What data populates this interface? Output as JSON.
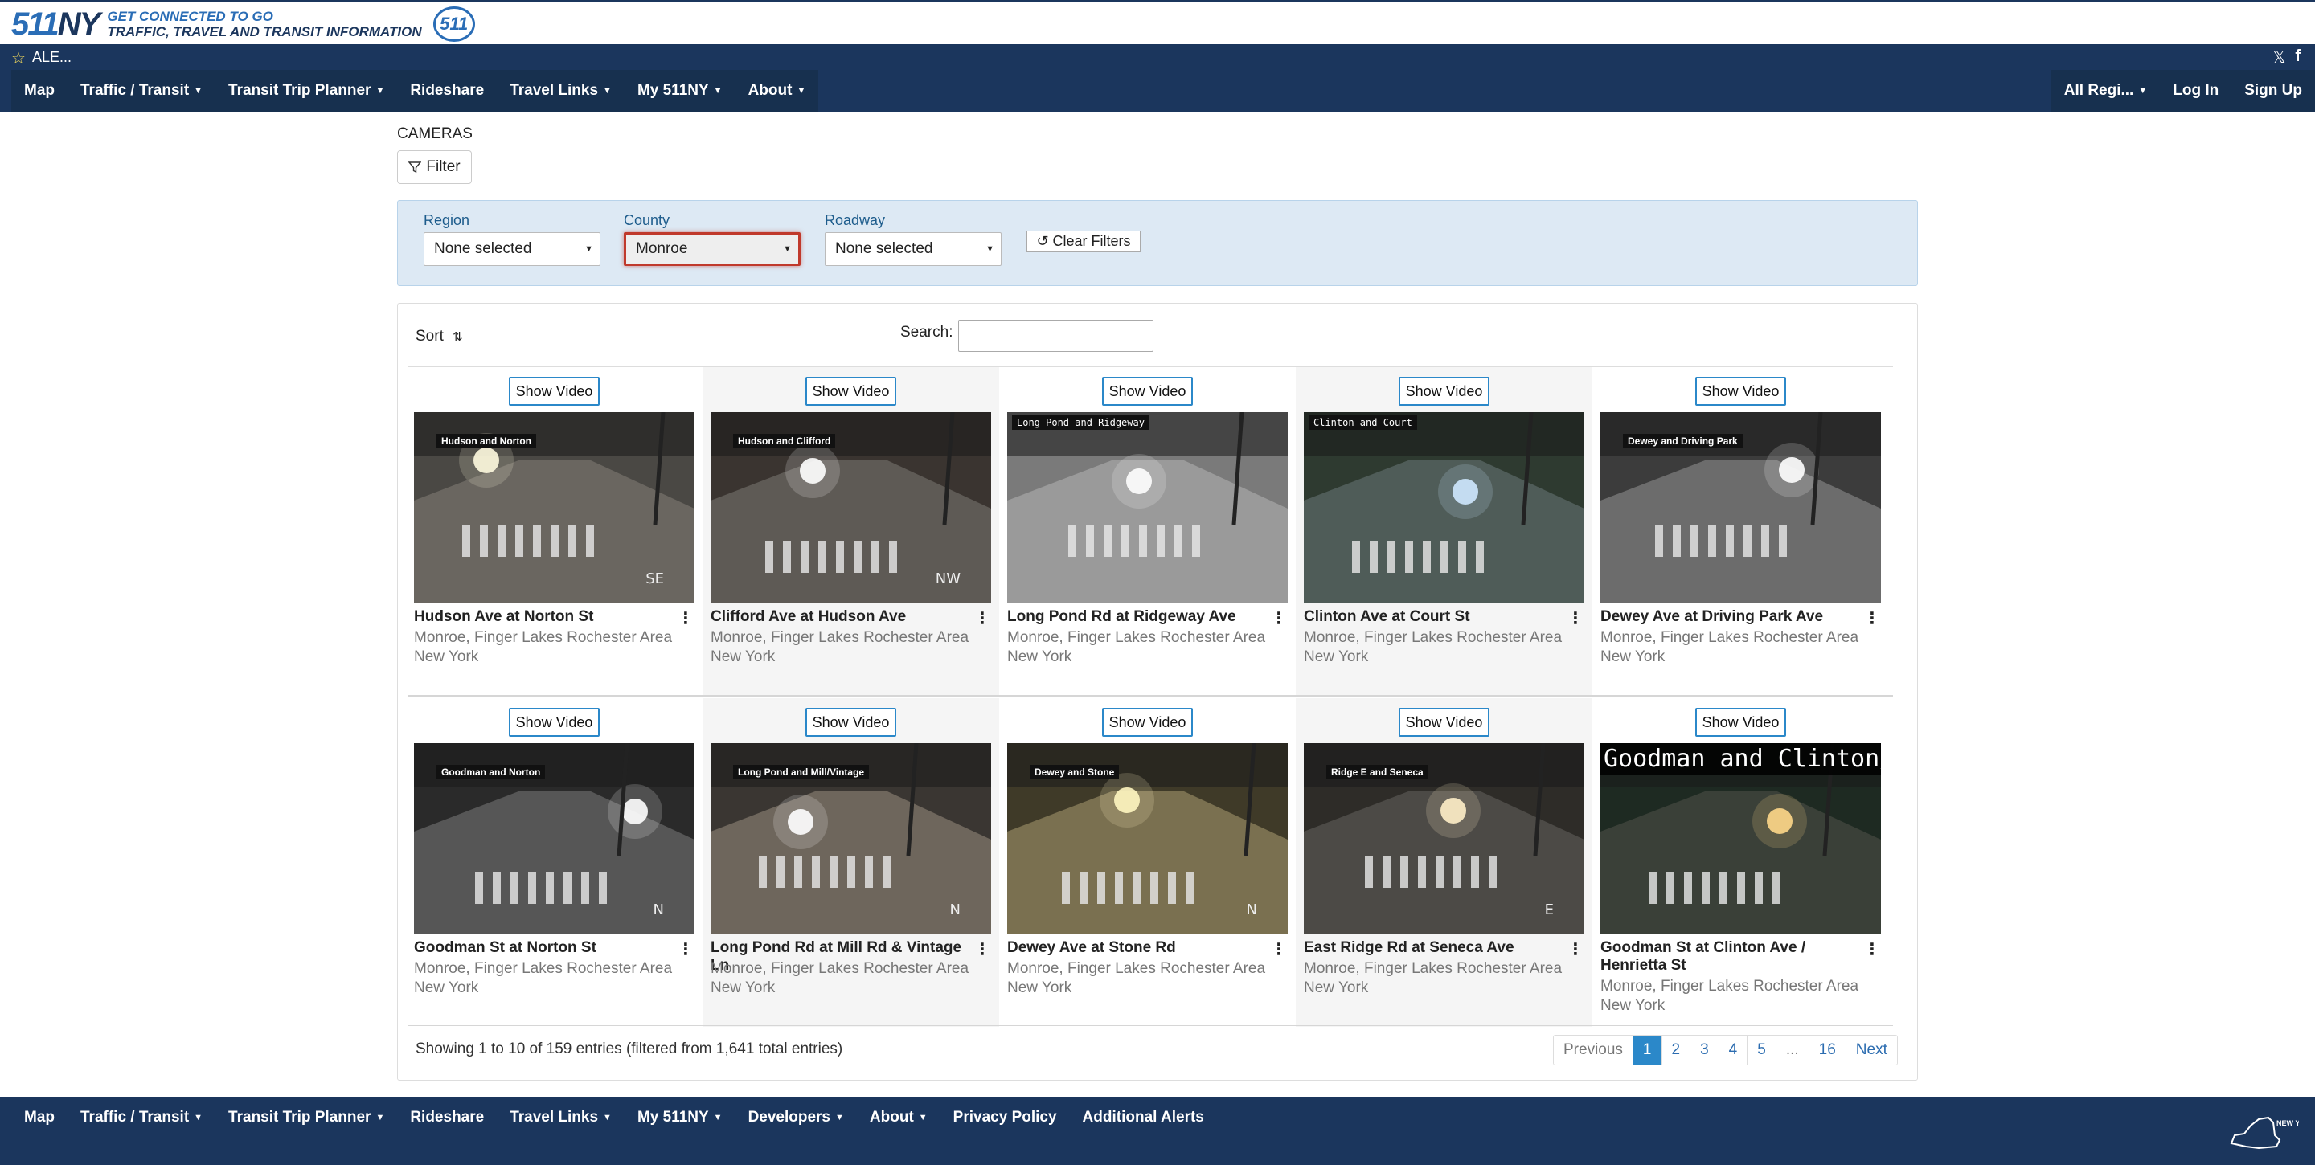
{
  "header": {
    "logo_511": "511",
    "logo_ny": "NY",
    "tagline_1": "GET CONNECTED TO GO",
    "tagline_2": "TRAFFIC, TRAVEL AND TRANSIT INFORMATION",
    "badge": "511"
  },
  "alert": {
    "text": "ALE..."
  },
  "nav": {
    "left": [
      {
        "label": "Map",
        "caret": false
      },
      {
        "label": "Traffic / Transit",
        "caret": true
      },
      {
        "label": "Transit Trip Planner",
        "caret": true
      },
      {
        "label": "Rideshare",
        "caret": false
      },
      {
        "label": "Travel Links",
        "caret": true
      },
      {
        "label": "My 511NY",
        "caret": true
      },
      {
        "label": "About",
        "caret": true
      }
    ],
    "right": [
      {
        "label": "All Regi...",
        "caret": true
      },
      {
        "label": "Log In",
        "caret": false
      },
      {
        "label": "Sign Up",
        "caret": false
      }
    ]
  },
  "page": {
    "heading": "CAMERAS",
    "filter_button": "Filter"
  },
  "filters": {
    "region": {
      "label": "Region",
      "value": "None selected"
    },
    "county": {
      "label": "County",
      "value": "Monroe"
    },
    "roadway": {
      "label": "Roadway",
      "value": "None selected"
    },
    "clear_label": "Clear Filters"
  },
  "table": {
    "sort_label": "Sort",
    "search_label": "Search:",
    "search_value": "",
    "show_video_label": "Show Video",
    "cameras": [
      {
        "title": "Hudson Ave at Norton St",
        "loc1": "Monroe, Finger Lakes Rochester Area",
        "loc2": "New York",
        "tag": "Hudson and Norton",
        "dir": "SE"
      },
      {
        "title": "Clifford Ave at Hudson Ave",
        "loc1": "Monroe, Finger Lakes Rochester Area",
        "loc2": "New York",
        "tag": "Hudson and Clifford",
        "dir": "NW"
      },
      {
        "title": "Long Pond Rd at Ridgeway Ave",
        "loc1": "Monroe, Finger Lakes Rochester Area",
        "loc2": "New York",
        "tag": "Long Pond and Ridgeway",
        "dir": ""
      },
      {
        "title": "Clinton Ave at Court St",
        "loc1": "Monroe, Finger Lakes Rochester Area",
        "loc2": "New York",
        "tag": "Clinton and Court",
        "dir": ""
      },
      {
        "title": "Dewey Ave at Driving Park Ave",
        "loc1": "Monroe, Finger Lakes Rochester Area",
        "loc2": "New York",
        "tag": "Dewey and Driving Park",
        "dir": ""
      },
      {
        "title": "Goodman St at Norton St",
        "loc1": "Monroe, Finger Lakes Rochester Area",
        "loc2": "New York",
        "tag": "Goodman and Norton",
        "dir": "N"
      },
      {
        "title": "Long Pond Rd at Mill Rd & Vintage Ln",
        "loc1": "Monroe, Finger Lakes Rochester Area",
        "loc2": "New York",
        "tag": "Long Pond and Mill/Vintage",
        "dir": "N"
      },
      {
        "title": "Dewey Ave at Stone Rd",
        "loc1": "Monroe, Finger Lakes Rochester Area",
        "loc2": "New York",
        "tag": "Dewey and Stone",
        "dir": "N"
      },
      {
        "title": "East Ridge Rd at Seneca Ave",
        "loc1": "Monroe, Finger Lakes Rochester Area",
        "loc2": "New York",
        "tag": "Ridge E and Seneca",
        "dir": "E"
      },
      {
        "title": "Goodman St at Clinton Ave / Henrietta St",
        "loc1": "Monroe, Finger Lakes Rochester Area",
        "loc2": "New York",
        "tag": "Goodman and Clinton/",
        "dir": ""
      }
    ],
    "entries_info": "Showing 1 to 10 of 159 entries (filtered from 1,641 total entries)",
    "pagination": [
      "Previous",
      "1",
      "2",
      "3",
      "4",
      "5",
      "...",
      "16",
      "Next"
    ],
    "current_page": "1"
  },
  "footer": {
    "nav": [
      {
        "label": "Map",
        "caret": false
      },
      {
        "label": "Traffic / Transit",
        "caret": true
      },
      {
        "label": "Transit Trip Planner",
        "caret": true
      },
      {
        "label": "Rideshare",
        "caret": false
      },
      {
        "label": "Travel Links",
        "caret": true
      },
      {
        "label": "My 511NY",
        "caret": true
      },
      {
        "label": "Developers",
        "caret": true
      },
      {
        "label": "About",
        "caret": true
      },
      {
        "label": "Privacy Policy",
        "caret": false
      },
      {
        "label": "Additional Alerts",
        "caret": false
      }
    ],
    "state_logo_text": "NEW YORK STATE"
  },
  "colors": {
    "nav_bg": "#1b365d",
    "accent": "#2b88c9",
    "filter_panel": "#dde9f4",
    "active_select_border": "#c0392b"
  }
}
